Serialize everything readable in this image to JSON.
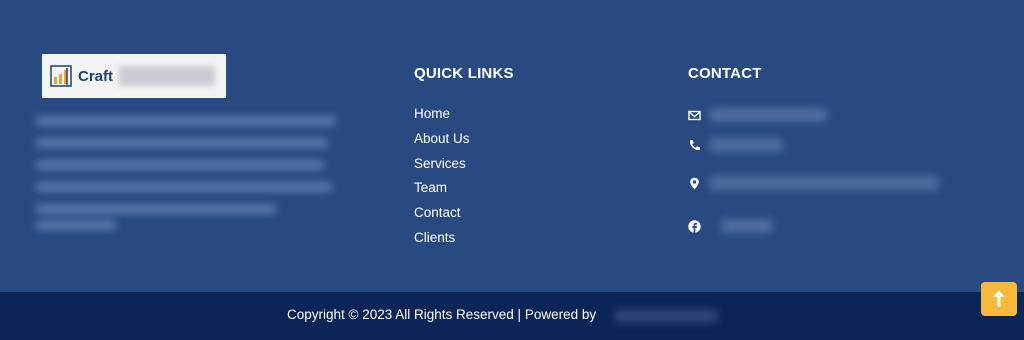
{
  "brand": {
    "logo_text": "Craft",
    "logo_icon": "bar-chart-logo-icon"
  },
  "quick_links": {
    "heading": "QUICK LINKS",
    "items": [
      {
        "label": "Home"
      },
      {
        "label": "About Us"
      },
      {
        "label": "Services"
      },
      {
        "label": "Team"
      },
      {
        "label": "Contact"
      },
      {
        "label": "Clients"
      }
    ]
  },
  "contact": {
    "heading": "CONTACT",
    "icons": [
      "envelope-icon",
      "phone-icon",
      "map-pin-icon",
      "facebook-icon"
    ]
  },
  "footer_bar": {
    "copyright": "Copyright © 2023 All Rights Reserved | Powered by"
  },
  "back_to_top": {
    "icon": "arrow-up-icon"
  },
  "colors": {
    "main_bg": "#294a80",
    "bar_bg": "#0c2557",
    "accent": "#f6b93b",
    "text": "#ffffff"
  }
}
